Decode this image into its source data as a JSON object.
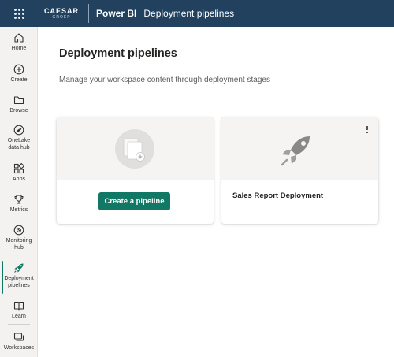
{
  "topbar": {
    "brand_name": "CAESAR",
    "brand_sub": "GROEP",
    "product": "Power BI",
    "breadcrumb": "Deployment pipelines"
  },
  "nav": {
    "home": "Home",
    "create": "Create",
    "browse": "Browse",
    "onelake_line1": "OneLake",
    "onelake_line2": "data hub",
    "apps": "Apps",
    "metrics": "Metrics",
    "monitoring_line1": "Monitoring",
    "monitoring_line2": "hub",
    "deployment_line1": "Deployment",
    "deployment_line2": "pipelines",
    "learn": "Learn",
    "workspaces": "Workspaces"
  },
  "main": {
    "title": "Deployment pipelines",
    "subtitle": "Manage your workspace content through deployment stages",
    "create_button": "Create a pipeline",
    "pipelines": [
      {
        "name": "Sales Report Deployment"
      }
    ]
  },
  "colors": {
    "topbar_bg": "#22415f",
    "accent": "#117865",
    "nav_bg": "#f3f2f1"
  }
}
